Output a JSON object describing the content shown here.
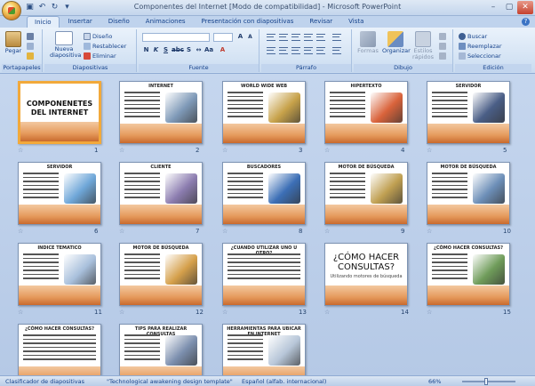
{
  "window": {
    "title": "Componentes del Internet [Modo de compatibilidad] - Microsoft PowerPoint"
  },
  "tabs": [
    {
      "label": "Inicio",
      "active": true
    },
    {
      "label": "Insertar"
    },
    {
      "label": "Diseño"
    },
    {
      "label": "Animaciones"
    },
    {
      "label": "Presentación con diapositivas"
    },
    {
      "label": "Revisar"
    },
    {
      "label": "Vista"
    }
  ],
  "ribbon": {
    "clipboard": {
      "label": "Portapapeles",
      "paste": "Pegar"
    },
    "slides": {
      "label": "Diapositivas",
      "new_slide": "Nueva diapositiva",
      "layout": "Diseño",
      "reset": "Restablecer",
      "delete": "Eliminar"
    },
    "font": {
      "label": "Fuente"
    },
    "paragraph": {
      "label": "Párrafo"
    },
    "drawing": {
      "label": "Dibujo",
      "shapes": "Formas",
      "arrange": "Organizar",
      "quick_styles": "Estilos rápidos"
    },
    "editing": {
      "label": "Edición",
      "find": "Buscar",
      "replace": "Reemplazar",
      "select": "Seleccionar"
    }
  },
  "slides": [
    {
      "n": "1",
      "kind": "title",
      "title": "COMPONENETES DEL INTERNET"
    },
    {
      "n": "2",
      "kind": "content",
      "title": "INTERNET",
      "pic": "#7f9ab8"
    },
    {
      "n": "3",
      "kind": "content",
      "title": "WORLD WIDE WEB",
      "pic": "#c7a24a"
    },
    {
      "n": "4",
      "kind": "content",
      "title": "HIPERTEXTO",
      "pic": "#d9633b"
    },
    {
      "n": "5",
      "kind": "content",
      "title": "SERVIDOR",
      "pic": "#4a5e86"
    },
    {
      "n": "6",
      "kind": "content",
      "title": "SERVIDOR",
      "pic": "#6fa7d8"
    },
    {
      "n": "7",
      "kind": "content",
      "title": "CLIENTE",
      "pic": "#8c7db0"
    },
    {
      "n": "8",
      "kind": "content",
      "title": "BUSCADORES",
      "pic": "#3c6fb6"
    },
    {
      "n": "9",
      "kind": "content",
      "title": "MOTOR DE BÚSQUEDA",
      "pic": "#c0a052"
    },
    {
      "n": "10",
      "kind": "content",
      "title": "MOTOR DE BÚSQUEDA",
      "pic": "#6d8fb8"
    },
    {
      "n": "11",
      "kind": "content",
      "title": "INDICE TEMATICO",
      "pic": "#a9c0dc"
    },
    {
      "n": "12",
      "kind": "content",
      "title": "MOTOR DE BÚSQUEDA",
      "pic": "#d5a04b"
    },
    {
      "n": "13",
      "kind": "content",
      "title": "¿CUANDO UTILIZAR UNO U OTRO?",
      "pic": ""
    },
    {
      "n": "14",
      "kind": "title2",
      "title": "¿CÓMO HACER CONSULTAS?",
      "sub": "Utilizando motores de búsqueda"
    },
    {
      "n": "15",
      "kind": "content",
      "title": "¿CÓMO HACER CONSULTAS?",
      "pic": "#6f9c5a"
    },
    {
      "n": "16",
      "kind": "content",
      "title": "¿CÓMO HACER CONSULTAS?",
      "pic": ""
    },
    {
      "n": "17",
      "kind": "content",
      "title": "TIPS PARA REALIZAR CONSULTAS",
      "pic": "#7c8fae"
    },
    {
      "n": "18",
      "kind": "content",
      "title": "HERRAMIENTAS PARA UBICAR EN INTERNET",
      "pic": "#b7c6d8"
    }
  ],
  "status": {
    "view": "Clasificador de diapositivas",
    "theme": "\"Technological awakening design template\"",
    "language": "Español (alfab. internacional)",
    "zoom": "66%"
  }
}
